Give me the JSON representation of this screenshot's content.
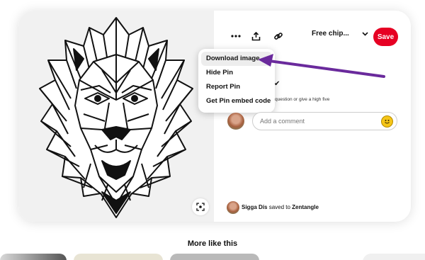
{
  "pin": {
    "image_alt": "Geometric zentangle lion head line art"
  },
  "toolbar": {
    "more_icon": "ellipsis-icon",
    "share_icon": "share-upload-icon",
    "link_icon": "link-icon",
    "board_label": "Free chip...",
    "board_chevron_icon": "chevron-down-icon",
    "save_label": "Save"
  },
  "menu": {
    "items": [
      {
        "label": "Download image"
      },
      {
        "label": "Hide Pin"
      },
      {
        "label": "Report Pin"
      },
      {
        "label": "Get Pin embed code"
      }
    ]
  },
  "behind_menu": {
    "check": "✔",
    "prompt": "question or give a high five"
  },
  "comments": {
    "placeholder": "Add a comment",
    "emoji_icon": "emoji-icon"
  },
  "saved_by": {
    "user": "Sigga Dís",
    "action": "saved to",
    "board": "Zentangle"
  },
  "section": {
    "title": "More like this"
  },
  "colors": {
    "save": "#e60023",
    "annotation_arrow": "#6a2a9c"
  }
}
